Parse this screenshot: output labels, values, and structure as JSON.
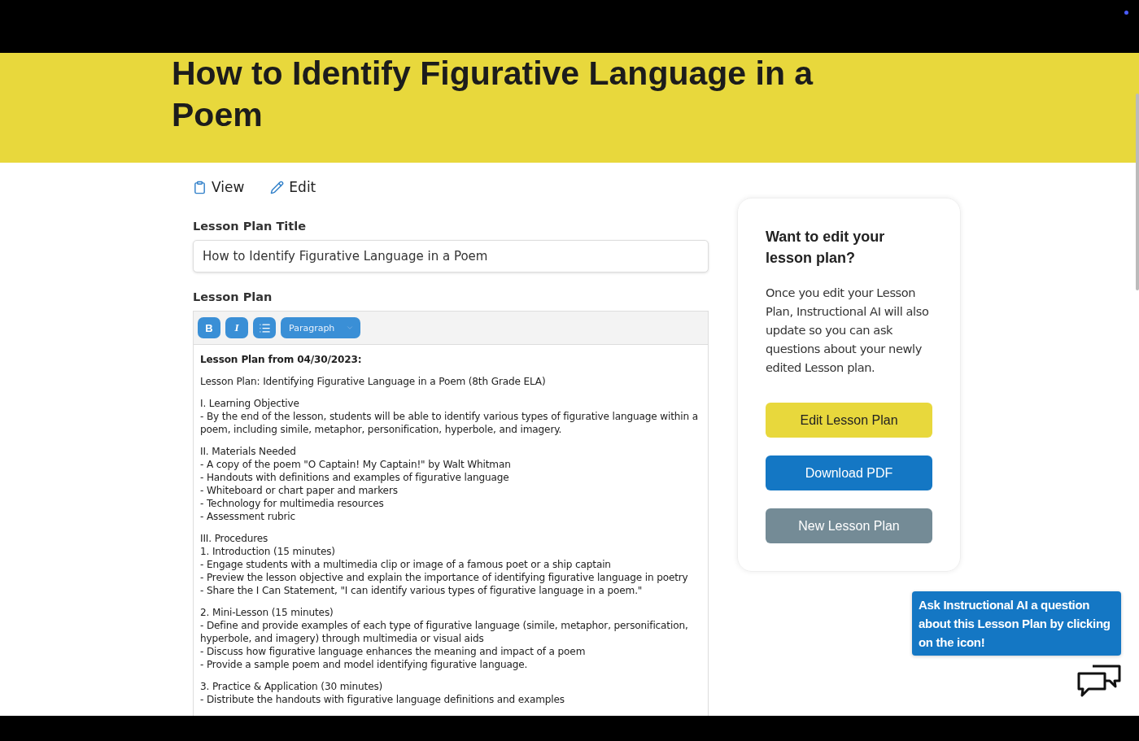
{
  "header": {
    "title": "How to Identify Figurative Language in a Poem"
  },
  "tabs": [
    {
      "label": "View",
      "kind": "view"
    },
    {
      "label": "Edit",
      "kind": "edit"
    }
  ],
  "title_field": {
    "label": "Lesson Plan Title",
    "value": "How to Identify Figurative Language in a Poem"
  },
  "editor": {
    "label": "Lesson Plan",
    "toolbar": [
      {
        "kind": "bold",
        "label": "B"
      },
      {
        "kind": "italic",
        "label": "I"
      },
      {
        "kind": "list"
      },
      {
        "kind": "select",
        "label": "Paragraph"
      }
    ],
    "blocks": [
      {
        "kind": "heading",
        "lines": [
          "Lesson Plan from 04/30/2023:"
        ]
      },
      {
        "kind": "text",
        "lines": [
          "Lesson Plan: Identifying Figurative Language in a Poem (8th Grade ELA)"
        ]
      },
      {
        "kind": "text",
        "lines": [
          "I. Learning Objective",
          "- By the end of the lesson, students will be able to identify various types of figurative language within a poem, including simile, metaphor, personification, hyperbole, and imagery."
        ]
      },
      {
        "kind": "text",
        "lines": [
          "II. Materials Needed",
          "- A copy of the poem \"O Captain! My Captain!\" by Walt Whitman",
          "- Handouts with definitions and examples of figurative language",
          "- Whiteboard or chart paper and markers",
          "- Technology for multimedia resources",
          "- Assessment rubric"
        ]
      },
      {
        "kind": "text",
        "lines": [
          "III. Procedures",
          "1. Introduction (15 minutes)",
          "- Engage students with a multimedia clip or image of a famous poet or a ship captain",
          "- Preview the lesson objective and explain the importance of identifying figurative language in poetry",
          "- Share the I Can Statement, \"I can identify various types of figurative language in a poem.\""
        ]
      },
      {
        "kind": "text",
        "lines": [
          "2. Mini-Lesson (15 minutes)",
          "- Define and provide examples of each type of figurative language (simile, metaphor, personification, hyperbole, and imagery) through multimedia or visual aids",
          "- Discuss how figurative language enhances the meaning and impact of a poem",
          "- Provide a sample poem and model identifying figurative language."
        ]
      },
      {
        "kind": "text",
        "lines": [
          "3. Practice & Application (30 minutes)",
          "- Distribute the handouts with figurative language definitions and examples"
        ]
      }
    ]
  },
  "card": {
    "title": "Want to edit your lesson plan?",
    "body": "Once you edit your Lesson Plan, Instructional AI will also update so you can ask questions about your newly edited Lesson plan.",
    "buttons": [
      {
        "label": "Edit Lesson Plan",
        "kind": "primary"
      },
      {
        "label": "Download PDF",
        "kind": "download"
      },
      {
        "label": "New Lesson Plan",
        "kind": "secondary"
      }
    ]
  },
  "chat_tip": {
    "text": "Ask Instructional AI a question about this Lesson Plan by clicking on the icon!"
  }
}
